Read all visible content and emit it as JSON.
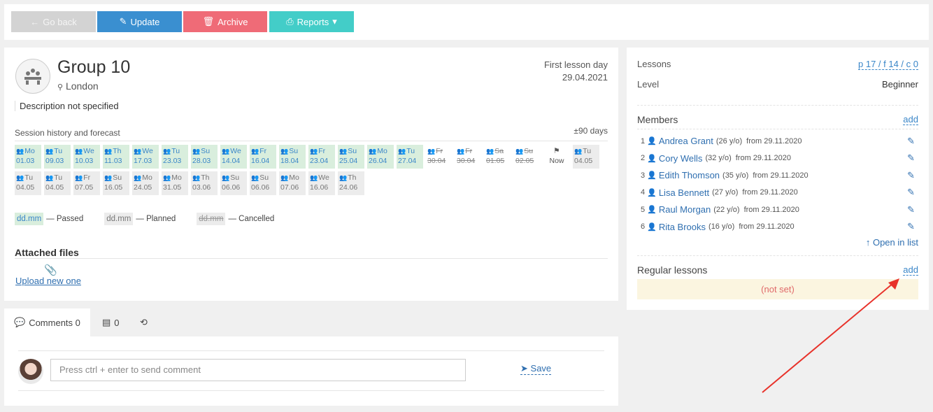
{
  "toolbar": {
    "back": "Go back",
    "update": "Update",
    "archive": "Archive",
    "reports": "Reports"
  },
  "group": {
    "title": "Group 10",
    "location": "London",
    "first_lesson_label": "First lesson day",
    "first_lesson_date": "29.04.2021",
    "description": "Description not specified"
  },
  "history": {
    "title": "Session history and forecast",
    "range": "±90 days",
    "row1": [
      {
        "day": "Mo",
        "date": "01.03",
        "state": "passed"
      },
      {
        "day": "Tu",
        "date": "09.03",
        "state": "passed"
      },
      {
        "day": "We",
        "date": "10.03",
        "state": "passed"
      },
      {
        "day": "Th",
        "date": "11.03",
        "state": "passed"
      },
      {
        "day": "We",
        "date": "17.03",
        "state": "passed"
      },
      {
        "day": "Tu",
        "date": "23.03",
        "state": "passed"
      },
      {
        "day": "Su",
        "date": "28.03",
        "state": "passed"
      },
      {
        "day": "We",
        "date": "14.04",
        "state": "passed"
      },
      {
        "day": "Fr",
        "date": "16.04",
        "state": "passed"
      },
      {
        "day": "Su",
        "date": "18.04",
        "state": "passed"
      },
      {
        "day": "Fr",
        "date": "23.04",
        "state": "passed"
      },
      {
        "day": "Su",
        "date": "25.04",
        "state": "passed"
      },
      {
        "day": "Mo",
        "date": "26.04",
        "state": "passed"
      },
      {
        "day": "Tu",
        "date": "27.04",
        "state": "passed"
      },
      {
        "day": "Fr",
        "date": "30.04",
        "state": "cancelled"
      },
      {
        "day": "Fr",
        "date": "30.04",
        "state": "cancelled"
      },
      {
        "day": "Sa",
        "date": "01.05",
        "state": "cancelled"
      },
      {
        "day": "Su",
        "date": "02.05",
        "state": "cancelled"
      },
      {
        "day": "",
        "date": "Now",
        "state": "now"
      },
      {
        "day": "Tu",
        "date": "04.05",
        "state": "planned"
      }
    ],
    "row2": [
      {
        "day": "Tu",
        "date": "04.05",
        "state": "planned"
      },
      {
        "day": "Tu",
        "date": "04.05",
        "state": "planned"
      },
      {
        "day": "Fr",
        "date": "07.05",
        "state": "planned"
      },
      {
        "day": "Su",
        "date": "16.05",
        "state": "planned"
      },
      {
        "day": "Mo",
        "date": "24.05",
        "state": "planned"
      },
      {
        "day": "Mo",
        "date": "31.05",
        "state": "planned"
      },
      {
        "day": "Th",
        "date": "03.06",
        "state": "planned"
      },
      {
        "day": "Su",
        "date": "06.06",
        "state": "planned"
      },
      {
        "day": "Su",
        "date": "06.06",
        "state": "planned"
      },
      {
        "day": "Mo",
        "date": "07.06",
        "state": "planned"
      },
      {
        "day": "We",
        "date": "16.06",
        "state": "planned"
      },
      {
        "day": "Th",
        "date": "24.06",
        "state": "planned"
      }
    ],
    "legend": {
      "chip": "dd.mm",
      "passed": "— Passed",
      "planned": "— Planned",
      "cancelled": "— Cancelled"
    }
  },
  "attached": {
    "title": "Attached files",
    "upload": "Upload new one"
  },
  "side": {
    "lessons_label": "Lessons",
    "lessons_value": "p 17 / f 14 / c 0",
    "level_label": "Level",
    "level_value": "Beginner",
    "members_title": "Members",
    "members_add": "add",
    "members": [
      {
        "num": "1",
        "name": "Andrea Grant",
        "age": "(26 y/o)",
        "from": "from 29.11.2020"
      },
      {
        "num": "2",
        "name": "Cory Wells",
        "age": "(32 y/o)",
        "from": "from 29.11.2020"
      },
      {
        "num": "3",
        "name": "Edith Thomson",
        "age": "(35 y/o)",
        "from": "from 29.11.2020"
      },
      {
        "num": "4",
        "name": "Lisa Bennett",
        "age": "(27 y/o)",
        "from": "from 29.11.2020"
      },
      {
        "num": "5",
        "name": "Raul Morgan",
        "age": "(22 y/o)",
        "from": "from 29.11.2020"
      },
      {
        "num": "6",
        "name": "Rita Brooks",
        "age": "(16 y/o)",
        "from": "from 29.11.2020"
      }
    ],
    "open_in_list": "Open in list",
    "regular_title": "Regular lessons",
    "regular_add": "add",
    "regular_value": "(not set)"
  },
  "comments": {
    "tab_comments": "Comments 0",
    "tab_notes": "0",
    "placeholder": "Press ctrl + enter to send comment",
    "save": "Save"
  },
  "colors": {
    "accent": "#3a8fd0",
    "archive": "#ef6b77",
    "reports": "#43cdc8",
    "passed_bg": "#d9eedd",
    "annotation_arrow": "#e8322a"
  }
}
